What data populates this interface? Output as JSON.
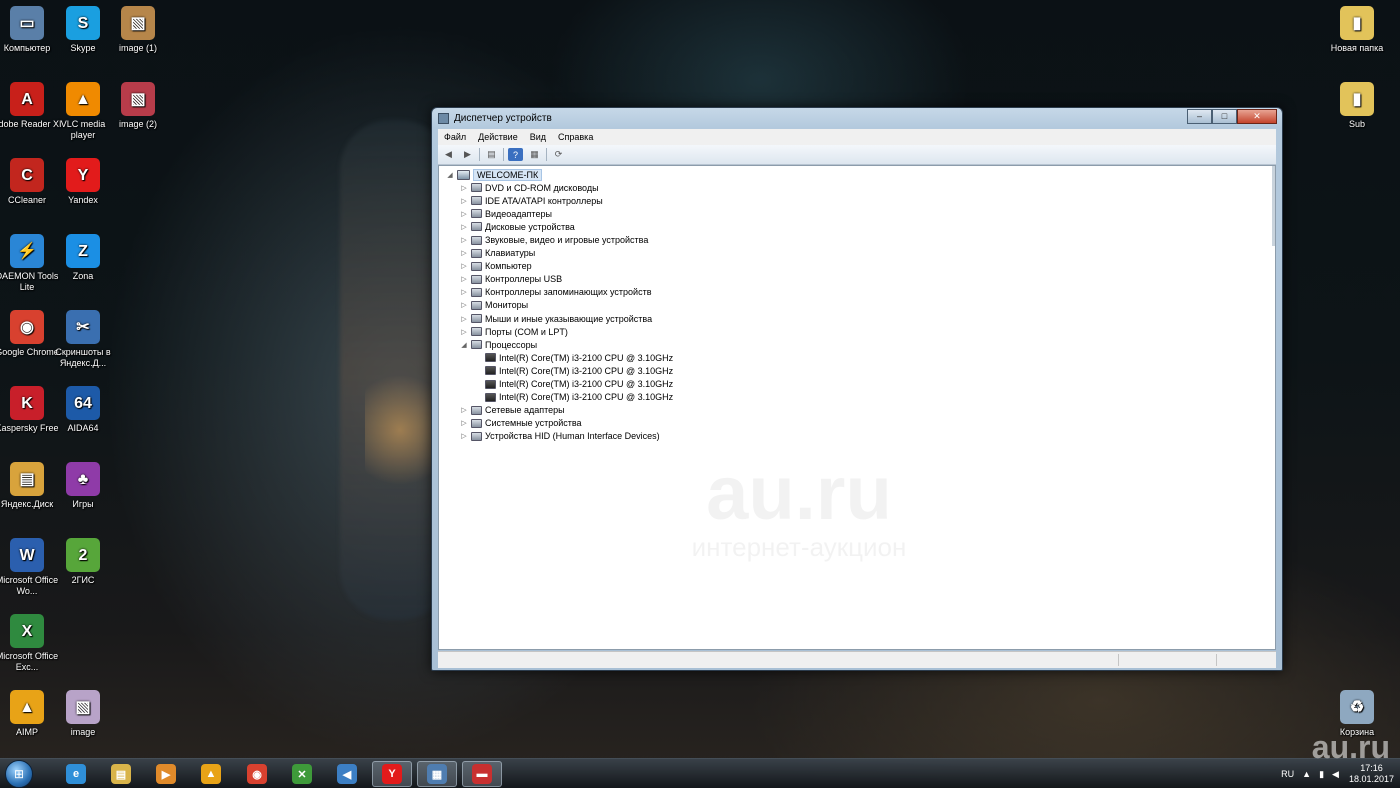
{
  "desktop": {
    "icons": [
      {
        "label": "Компьютер",
        "icon": "computer-icon",
        "color": "#5a7fa8",
        "glyph": "▭"
      },
      {
        "label": "Skype",
        "icon": "skype-icon",
        "color": "#1a9fe0",
        "glyph": "S"
      },
      {
        "label": "image (1)",
        "icon": "image-file-icon",
        "color": "#b6864a",
        "glyph": "▧"
      },
      {
        "label": "Adobe Reader XI",
        "icon": "adobe-reader-icon",
        "color": "#c8201a",
        "glyph": "A"
      },
      {
        "label": "VLC media player",
        "icon": "vlc-icon",
        "color": "#f08a00",
        "glyph": "▲"
      },
      {
        "label": "image (2)",
        "icon": "image-file-icon",
        "color": "#b73c4a",
        "glyph": "▧"
      },
      {
        "label": "CCleaner",
        "icon": "ccleaner-icon",
        "color": "#c2261e",
        "glyph": "C"
      },
      {
        "label": "Yandex",
        "icon": "yandex-browser-icon",
        "color": "#e21b1b",
        "glyph": "Y"
      },
      {
        "label": "DAEMON Tools Lite",
        "icon": "daemon-tools-icon",
        "color": "#2a86d6",
        "glyph": "⚡"
      },
      {
        "label": "Zona",
        "icon": "zona-icon",
        "color": "#1b8fe4",
        "glyph": "Z"
      },
      {
        "label": "Google Chrome",
        "icon": "chrome-icon",
        "color": "#d8412f",
        "glyph": "◉"
      },
      {
        "label": "Скриншоты в Яндекс.Д...",
        "icon": "scissors-icon",
        "color": "#3a6fb0",
        "glyph": "✂"
      },
      {
        "label": "Kaspersky Free",
        "icon": "kaspersky-icon",
        "color": "#c81f2a",
        "glyph": "K"
      },
      {
        "label": "AIDA64",
        "icon": "aida64-icon",
        "color": "#1d5aa8",
        "glyph": "64"
      },
      {
        "label": "Яндекс.Диск",
        "icon": "yandex-disk-icon",
        "color": "#d8a33c",
        "glyph": "▤"
      },
      {
        "label": "Игры",
        "icon": "games-folder-icon",
        "color": "#8f3ba8",
        "glyph": "♣"
      },
      {
        "label": "Microsoft Office Wo...",
        "icon": "word-icon",
        "color": "#2b5fae",
        "glyph": "W"
      },
      {
        "label": "2ГИС",
        "icon": "2gis-icon",
        "color": "#57a63a",
        "glyph": "2"
      },
      {
        "label": "Microsoft Office Exc...",
        "icon": "excel-icon",
        "color": "#2f8a3f",
        "glyph": "X"
      },
      {
        "label": "AIMP",
        "icon": "aimp-icon",
        "color": "#e8a317",
        "glyph": "▲"
      },
      {
        "label": "image",
        "icon": "image-file-icon",
        "color": "#b8a3c8",
        "glyph": "▧"
      },
      {
        "label": "Новая папка",
        "icon": "folder-icon",
        "color": "#e2c35a",
        "glyph": "▮"
      },
      {
        "label": "Sub",
        "icon": "folder-icon",
        "color": "#e2c35a",
        "glyph": "▮"
      },
      {
        "label": "Корзина",
        "icon": "recycle-bin-icon",
        "color": "#8ea8c0",
        "glyph": "♻"
      }
    ]
  },
  "window": {
    "title": "Диспетчер устройств",
    "buttons": {
      "minimize": "‒",
      "maximize": "□",
      "close": "✕"
    },
    "menu": [
      "Файл",
      "Действие",
      "Вид",
      "Справка"
    ],
    "toolbar_icons": [
      "back-icon",
      "forward-icon",
      "properties-icon",
      "help-icon",
      "view-icon",
      "scan-hardware-icon"
    ]
  },
  "tree": {
    "root": "WELCOME-ПК",
    "items": [
      {
        "label": "DVD и CD-ROM дисководы",
        "level": 1,
        "expanded": false
      },
      {
        "label": "IDE ATA/ATAPI контроллеры",
        "level": 1,
        "expanded": false
      },
      {
        "label": "Видеоадаптеры",
        "level": 1,
        "expanded": false
      },
      {
        "label": "Дисковые устройства",
        "level": 1,
        "expanded": false
      },
      {
        "label": "Звуковые, видео и игровые устройства",
        "level": 1,
        "expanded": false
      },
      {
        "label": "Клавиатуры",
        "level": 1,
        "expanded": false
      },
      {
        "label": "Компьютер",
        "level": 1,
        "expanded": false
      },
      {
        "label": "Контроллеры USB",
        "level": 1,
        "expanded": false
      },
      {
        "label": "Контроллеры запоминающих устройств",
        "level": 1,
        "expanded": false
      },
      {
        "label": "Мониторы",
        "level": 1,
        "expanded": false
      },
      {
        "label": "Мыши и иные указывающие устройства",
        "level": 1,
        "expanded": false
      },
      {
        "label": "Порты (COM и LPT)",
        "level": 1,
        "expanded": false
      },
      {
        "label": "Процессоры",
        "level": 1,
        "expanded": true
      },
      {
        "label": "Intel(R) Core(TM) i3-2100 CPU @ 3.10GHz",
        "level": 2
      },
      {
        "label": "Intel(R) Core(TM) i3-2100 CPU @ 3.10GHz",
        "level": 2
      },
      {
        "label": "Intel(R) Core(TM) i3-2100 CPU @ 3.10GHz",
        "level": 2
      },
      {
        "label": "Intel(R) Core(TM) i3-2100 CPU @ 3.10GHz",
        "level": 2
      },
      {
        "label": "Сетевые адаптеры",
        "level": 1,
        "expanded": false
      },
      {
        "label": "Системные устройства",
        "level": 1,
        "expanded": false
      },
      {
        "label": "Устройства HID (Human Interface Devices)",
        "level": 1,
        "expanded": false
      }
    ]
  },
  "watermark": {
    "big": "au.ru",
    "small": "интернет-аукцион"
  },
  "taskbar": {
    "items": [
      {
        "icon": "internet-explorer-icon",
        "color": "#2f8fd8",
        "glyph": "e",
        "active": false
      },
      {
        "icon": "explorer-folder-icon",
        "color": "#d9b44a",
        "glyph": "▤",
        "active": false
      },
      {
        "icon": "media-player-icon",
        "color": "#e08a2a",
        "glyph": "▶",
        "active": false
      },
      {
        "icon": "aimp-icon",
        "color": "#e8a317",
        "glyph": "▲",
        "active": false
      },
      {
        "icon": "chrome-icon",
        "color": "#d8412f",
        "glyph": "◉",
        "active": false
      },
      {
        "icon": "xbox-icon",
        "color": "#3e9a3a",
        "glyph": "✕",
        "active": false
      },
      {
        "icon": "speaker-icon",
        "color": "#3c7fc4",
        "glyph": "◀",
        "active": false
      },
      {
        "icon": "yandex-browser-icon",
        "color": "#e21b1b",
        "glyph": "Y",
        "active": true
      },
      {
        "icon": "device-manager-icon",
        "color": "#4f7db0",
        "glyph": "▦",
        "active": true
      },
      {
        "icon": "toolbox-icon",
        "color": "#c83030",
        "glyph": "▬",
        "active": true
      }
    ],
    "tray": {
      "language": "RU",
      "time": "17:16",
      "date": "18.01.2017"
    }
  },
  "site_watermark": "au.ru"
}
